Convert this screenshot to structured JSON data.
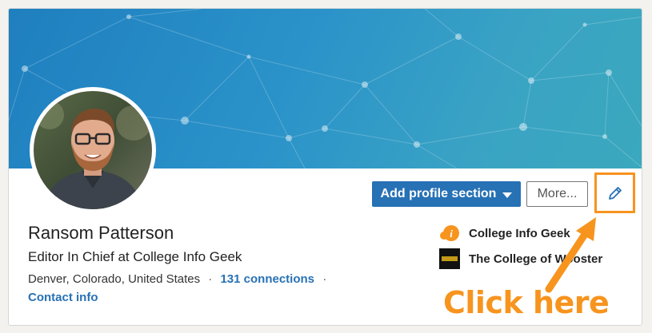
{
  "profile": {
    "name": "Ransom Patterson",
    "headline": "Editor In Chief at College Info Geek",
    "location": "Denver, Colorado, United States",
    "separator": "·",
    "connections": "131 connections",
    "contact_info": "Contact info"
  },
  "actions": {
    "add_section_label": "Add profile section",
    "more_label": "More..."
  },
  "organizations": [
    {
      "name": "College Info Geek",
      "icon": "college-info-geek-logo"
    },
    {
      "name": "The College of Wooster",
      "icon": "college-of-wooster-logo"
    }
  ],
  "annotation": {
    "text": "Click here",
    "color": "#f7941e"
  },
  "colors": {
    "accent": "#2771b5",
    "banner_start": "#1f7fbf",
    "banner_end": "#3aa8bd",
    "highlight": "#f7941e"
  }
}
